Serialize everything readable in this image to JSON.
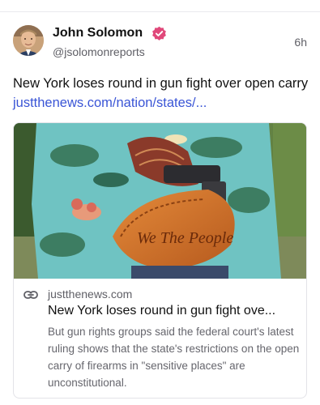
{
  "author": {
    "name": "John Solomon",
    "handle": "@jsolomonreports",
    "verified_color": "#e0487a"
  },
  "post": {
    "time": "6h",
    "text": "New York loses round in gun fight over open carry ",
    "link_text": "justthenews.com/nation/states/..."
  },
  "card": {
    "image_caption": "We The People",
    "domain": "justthenews.com",
    "title": "New York loses round in gun fight ove...",
    "description": "But gun rights groups said the federal court's latest ruling shows that the state's restrictions on the open carry of firearms in \"sensitive places\" are unconstitutional."
  },
  "colors": {
    "link": "#3a55d6",
    "secondary_text": "#5f5f66",
    "border": "#e3e3e8"
  }
}
